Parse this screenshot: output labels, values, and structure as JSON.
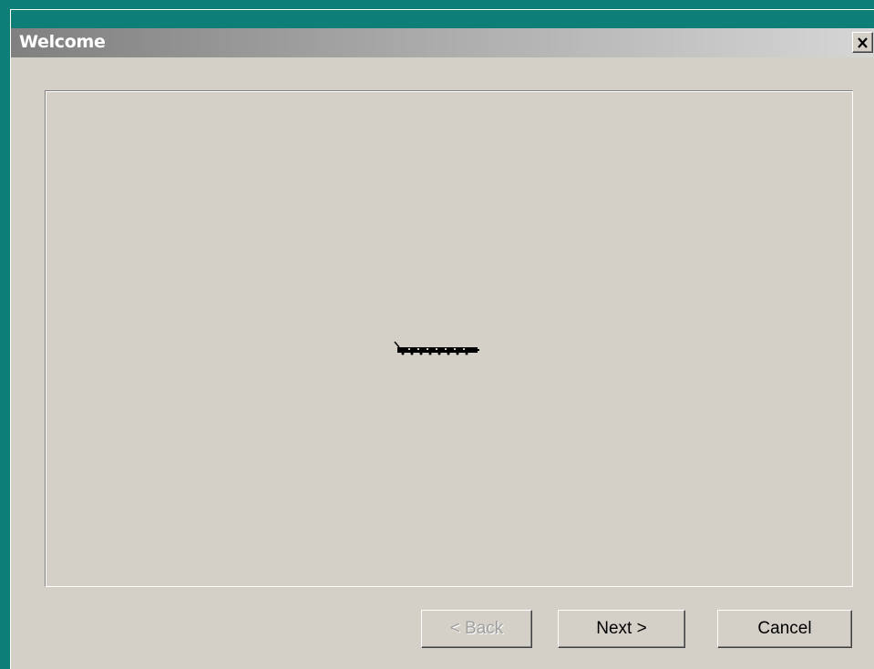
{
  "window": {
    "title": "Welcome",
    "close_glyph": "✕"
  },
  "content": {
    "icon": "loading-animation-icon"
  },
  "buttons": {
    "back_label": "< Back",
    "next_label": "Next >",
    "cancel_label": "Cancel",
    "back_enabled": false
  },
  "colors": {
    "desktop": "#0e7f78",
    "dialog_face": "#d4d0c8"
  }
}
